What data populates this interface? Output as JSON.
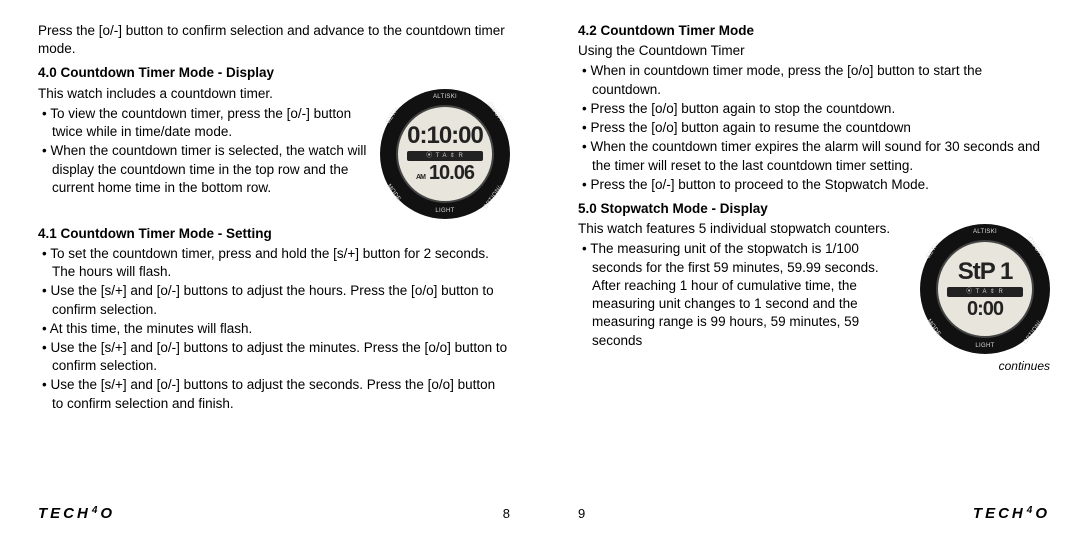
{
  "leftPage": {
    "intro": "Press the [o/-] button to confirm selection and advance to the countdown timer mode.",
    "s40_h": "4.0 Countdown Timer Mode - Display",
    "s40_p": "This watch includes a countdown timer.",
    "s40_li1": "To view the countdown timer, press the [o/-] button twice while in time/date mode.",
    "s40_li2": "When the countdown timer is selected, the watch will display the countdown time in the top row and the current home time in the bottom row.",
    "s41_h": "4.1 Countdown Timer Mode - Setting",
    "s41_li1": "To set the countdown timer, press and hold the [s/+] button for 2 seconds. The hours will flash.",
    "s41_li2": "Use the [s/+] and [o/-] buttons to adjust the hours. Press the [o/o] button to confirm selection.",
    "s41_li3": "At this time, the minutes will flash.",
    "s41_li4": "Use the [s/+] and [o/-] buttons to adjust the minutes. Press the [o/o] button to confirm selection.",
    "s41_li5": "Use the [s/+] and [o/-] buttons to adjust the seconds. Press the [o/o] button to confirm selection and finish.",
    "watch": {
      "row1": "0:10:00",
      "band": "⦿ T  A  ⇕  R",
      "am": "AM",
      "row2": "10.06",
      "altiski": "ALTISKI",
      "light": "LIGHT",
      "set": "SET/+",
      "onoff": "ON/OFF",
      "mode": "MODE",
      "option": "OPTION/-"
    },
    "pageNum": "8",
    "logo_main": "TECH",
    "logo_sup": "4",
    "logo_o": "O"
  },
  "rightPage": {
    "s42_h": "4.2 Countdown Timer Mode",
    "s42_p": "Using the Countdown Timer",
    "s42_li1": "When in countdown timer mode, press the [o/o] button to start the countdown.",
    "s42_li2": "Press the [o/o] button again to stop the countdown.",
    "s42_li3": "Press the [o/o] button again to resume the countdown",
    "s42_li4": "When the countdown timer expires the alarm will sound for 30 seconds and the timer will reset to the last countdown timer setting.",
    "s42_li5": "Press the [o/-] button to proceed to the Stopwatch Mode.",
    "s50_h": "5.0 Stopwatch Mode - Display",
    "s50_p": "This watch features 5 individual stopwatch counters.",
    "s50_li1": "The measuring unit of the stopwatch is 1/100 seconds for the first 59 minutes, 59.99 seconds. After reaching 1 hour of cumulative time, the measuring unit changes to 1 second and the measuring range is 99 hours, 59 minutes, 59 seconds",
    "watch": {
      "row1": "StP  1",
      "band": "⦿ T  A  ⇕  R",
      "row2": "0:00",
      "altiski": "ALTISKI",
      "light": "LIGHT",
      "set": "SET/+",
      "onoff": "ON/OFF",
      "mode": "MODE",
      "option": "OPTION/-"
    },
    "continues": "continues",
    "pageNum": "9",
    "logo_main": "TECH",
    "logo_sup": "4",
    "logo_o": "O"
  }
}
